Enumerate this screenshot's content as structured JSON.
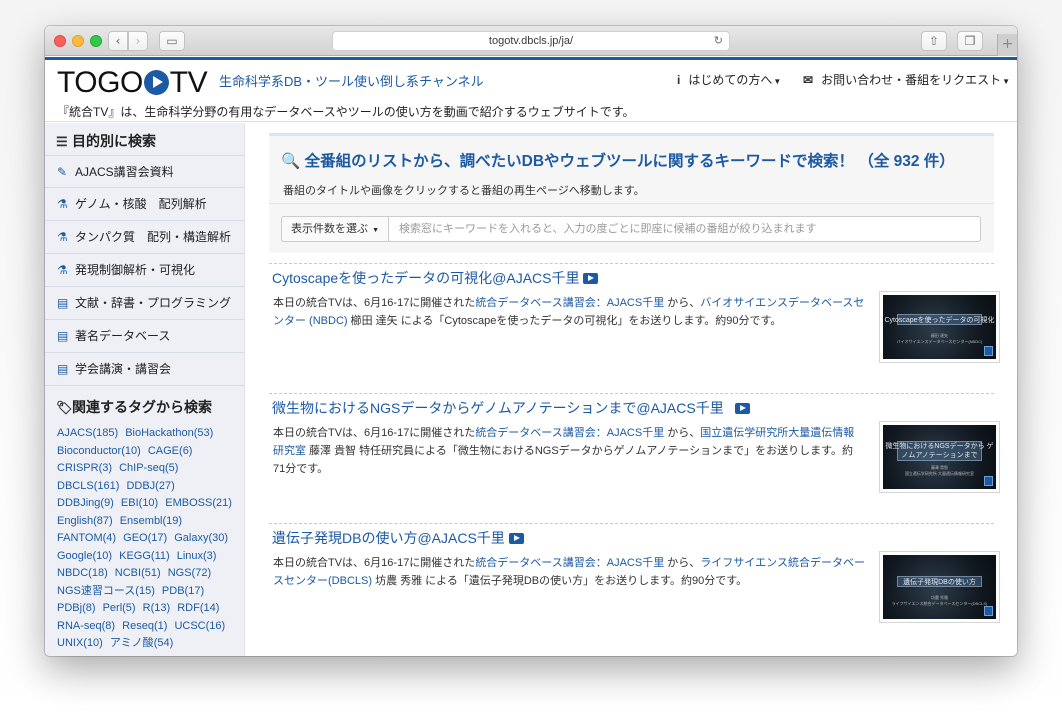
{
  "browser": {
    "url": "togotv.dbcls.jp/ja/",
    "back_glyph": "‹",
    "forward_glyph": "›",
    "sidebar_glyph": "▭",
    "reload_glyph": "↻",
    "share_glyph": "⇧",
    "tabs_glyph": "❐",
    "newtab_glyph": "+"
  },
  "header": {
    "logo_left": "TOGO",
    "logo_right": "TV",
    "tagline": "生命科学系DB・ツール使い倒し系チャンネル",
    "nav": [
      {
        "icon": "i",
        "label": "はじめての方へ"
      },
      {
        "icon": "✉",
        "label": "お問い合わせ・番組をリクエスト"
      }
    ],
    "description": "『統合TV』は、生命科学分野の有用なデータベースやツールの使い方を動画で紹介するウェブサイトです。"
  },
  "sidebar": {
    "purpose_heading": "目的別に検索",
    "purpose_items": [
      {
        "label": "AJACS講習会資料",
        "icon": "pencil-square-icon",
        "glyph": "✎"
      },
      {
        "label": "ゲノム・核酸　配列解析",
        "icon": "flask-icon",
        "glyph": "⚗"
      },
      {
        "label": "タンパク質　配列・構造解析",
        "icon": "flask-icon",
        "glyph": "⚗"
      },
      {
        "label": "発現制御解析・可視化",
        "icon": "flask-icon",
        "glyph": "⚗"
      },
      {
        "label": "文献・辞書・プログラミング",
        "icon": "book-icon",
        "glyph": "▤"
      },
      {
        "label": "著名データベース",
        "icon": "book-icon",
        "glyph": "▤"
      },
      {
        "label": "学会講演・講習会",
        "icon": "book-icon",
        "glyph": "▤"
      }
    ],
    "tags_heading": "関連するタグから検索",
    "tags": [
      {
        "name": "AJACS",
        "count": "(185)"
      },
      {
        "name": "BioHackathon",
        "count": "(53)"
      },
      {
        "name": "Bioconductor",
        "count": "(10)"
      },
      {
        "name": "CAGE",
        "count": "(6)"
      },
      {
        "name": "CRISPR",
        "count": "(3)"
      },
      {
        "name": "ChIP-seq",
        "count": "(5)"
      },
      {
        "name": "DBCLS",
        "count": "(161)"
      },
      {
        "name": "DDBJ",
        "count": "(27)"
      },
      {
        "name": "DDBJing",
        "count": "(9)"
      },
      {
        "name": "EBI",
        "count": "(10)"
      },
      {
        "name": "EMBOSS",
        "count": "(21)"
      },
      {
        "name": "English",
        "count": "(87)"
      },
      {
        "name": "Ensembl",
        "count": "(19)"
      },
      {
        "name": "FANTOM",
        "count": "(4)"
      },
      {
        "name": "GEO",
        "count": "(17)"
      },
      {
        "name": "Galaxy",
        "count": "(30)"
      },
      {
        "name": "Google",
        "count": "(10)"
      },
      {
        "name": "KEGG",
        "count": "(11)"
      },
      {
        "name": "Linux",
        "count": "(3)"
      },
      {
        "name": "NBDC",
        "count": "(18)"
      },
      {
        "name": "NCBI",
        "count": "(51)"
      },
      {
        "name": "NGS",
        "count": "(72)"
      },
      {
        "name": "NGS速習コース",
        "count": "(15)"
      },
      {
        "name": "PDB",
        "count": "(17)"
      },
      {
        "name": "PDBj",
        "count": "(8)"
      },
      {
        "name": "Perl",
        "count": "(5)"
      },
      {
        "name": "R",
        "count": "(13)"
      },
      {
        "name": "RDF",
        "count": "(14)"
      },
      {
        "name": "RNA-seq",
        "count": "(8)"
      },
      {
        "name": "Reseq",
        "count": "(1)"
      },
      {
        "name": "UCSC",
        "count": "(16)"
      },
      {
        "name": "UNIX",
        "count": "(10)"
      },
      {
        "name": "アミノ酸",
        "count": "(54)"
      }
    ]
  },
  "search": {
    "title": "全番組のリストから、調べたいDBやウェブツールに関するキーワードで検索！ （全 932 件）",
    "subtitle": "番組のタイトルや画像をクリックすると番組の再生ページへ移動します。",
    "per_page_label": "表示件数を選ぶ",
    "placeholder": "検索窓にキーワードを入れると、入力の度ごとに即座に候補の番組が絞り込まれます"
  },
  "programs": [
    {
      "title": "Cytoscapeを使ったデータの可視化@AJACS千里",
      "d1": "本日の統合TVは、6月16-17に開催された",
      "l1": "統合データベース講習会：AJACS千里",
      "d2": " から、",
      "l2": "バイオサイエンスデータベースセンター (NBDC)",
      "d3": " 櫛田 達矢 による「Cytoscapeを使ったデータの可視化」をお送りします。約90分です。",
      "thumb_title": "Cytoscapeを使ったデータの可視化",
      "thumb_presenter": "櫛田 達矢",
      "thumb_org": "バイオサイエンスデータベースセンター(NBDC)"
    },
    {
      "title": "微生物におけるNGSデータからゲノムアノテーションまで@AJACS千里",
      "d1": "本日の統合TVは、6月16-17に開催された",
      "l1": "統合データベース講習会：AJACS千里",
      "d2": " から、",
      "l2": "国立遺伝学研究所大量遺伝情報研究室",
      "d3": " 藤澤 貴智 特任研究員による「微生物におけるNGSデータからゲノムアノテーションまで」をお送りします。約71分です。",
      "thumb_title": "微生物におけるNGSデータから ゲノムアノテーションまで",
      "thumb_presenter": "藤澤 貴智",
      "thumb_org": "国立遺伝学研究所 大量遺伝情報研究室"
    },
    {
      "title": "遺伝子発現DBの使い方@AJACS千里",
      "d1": "本日の統合TVは、6月16-17に開催された",
      "l1": "統合データベース講習会：AJACS千里",
      "d2": " から、",
      "l2": "ライフサイエンス統合データベースセンター(DBCLS)",
      "d3": " 坊農 秀雅 による「遺伝子発現DBの使い方」をお送りします。約90分です。",
      "thumb_title": "遺伝子発現DBの使い方",
      "thumb_presenter": "坊農 秀雅",
      "thumb_org": "ライフサイエンス統合データベースセンター(DBCLS)"
    }
  ],
  "colors": {
    "brand_blue": "#1c5aa3",
    "sidebar_bg": "#eef0f6",
    "panel_bg": "#f6f6f6"
  }
}
